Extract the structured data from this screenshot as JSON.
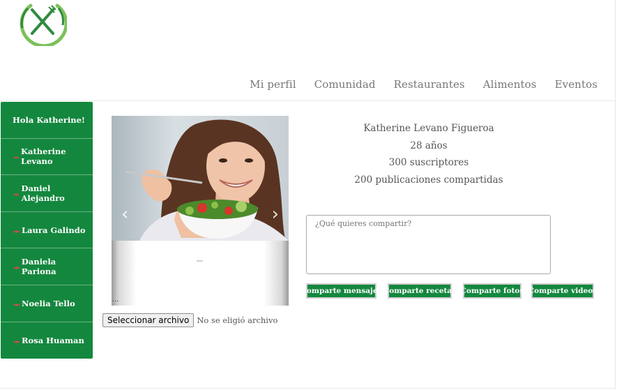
{
  "logo": {
    "icon": "fork-knife-logo-icon",
    "color": "#2f8a3e"
  },
  "nav": {
    "items": [
      "Mi perfil",
      "Comunidad",
      "Restaurantes",
      "Alimentos",
      "Eventos"
    ]
  },
  "sidebar": {
    "greeting": "Hola Katherine!",
    "icon": "arrow-bullet-icon",
    "items": [
      "Katherine Levano",
      "Daniel Alejandro",
      "Laura Galindo",
      "Daniela Pariona",
      "Noelia Tello",
      "Rosa Huaman"
    ],
    "bg_color": "#14873e"
  },
  "carousel": {
    "image": "woman-eating-salad-photo",
    "prev_icon": "chevron-left-icon",
    "next_icon": "chevron-right-icon",
    "prev_glyph": "‹",
    "next_glyph": "›",
    "caption": "..."
  },
  "file_input": {
    "button_label": "Seleccionar archivo",
    "status": "No se eligió archivo"
  },
  "profile": {
    "name": "Katherine Levano Figueroa",
    "age": "28 años",
    "subscribers": "300 suscriptores",
    "posts": "200 publicaciones compartidas"
  },
  "share": {
    "placeholder": "¿Qué quieres compartir?",
    "buttons": [
      "Comparte mensajes",
      "Comparte recetas",
      "Comparte fotos",
      "Comparte videos"
    ]
  },
  "colors": {
    "accent": "#14873e",
    "text": "#555555"
  }
}
